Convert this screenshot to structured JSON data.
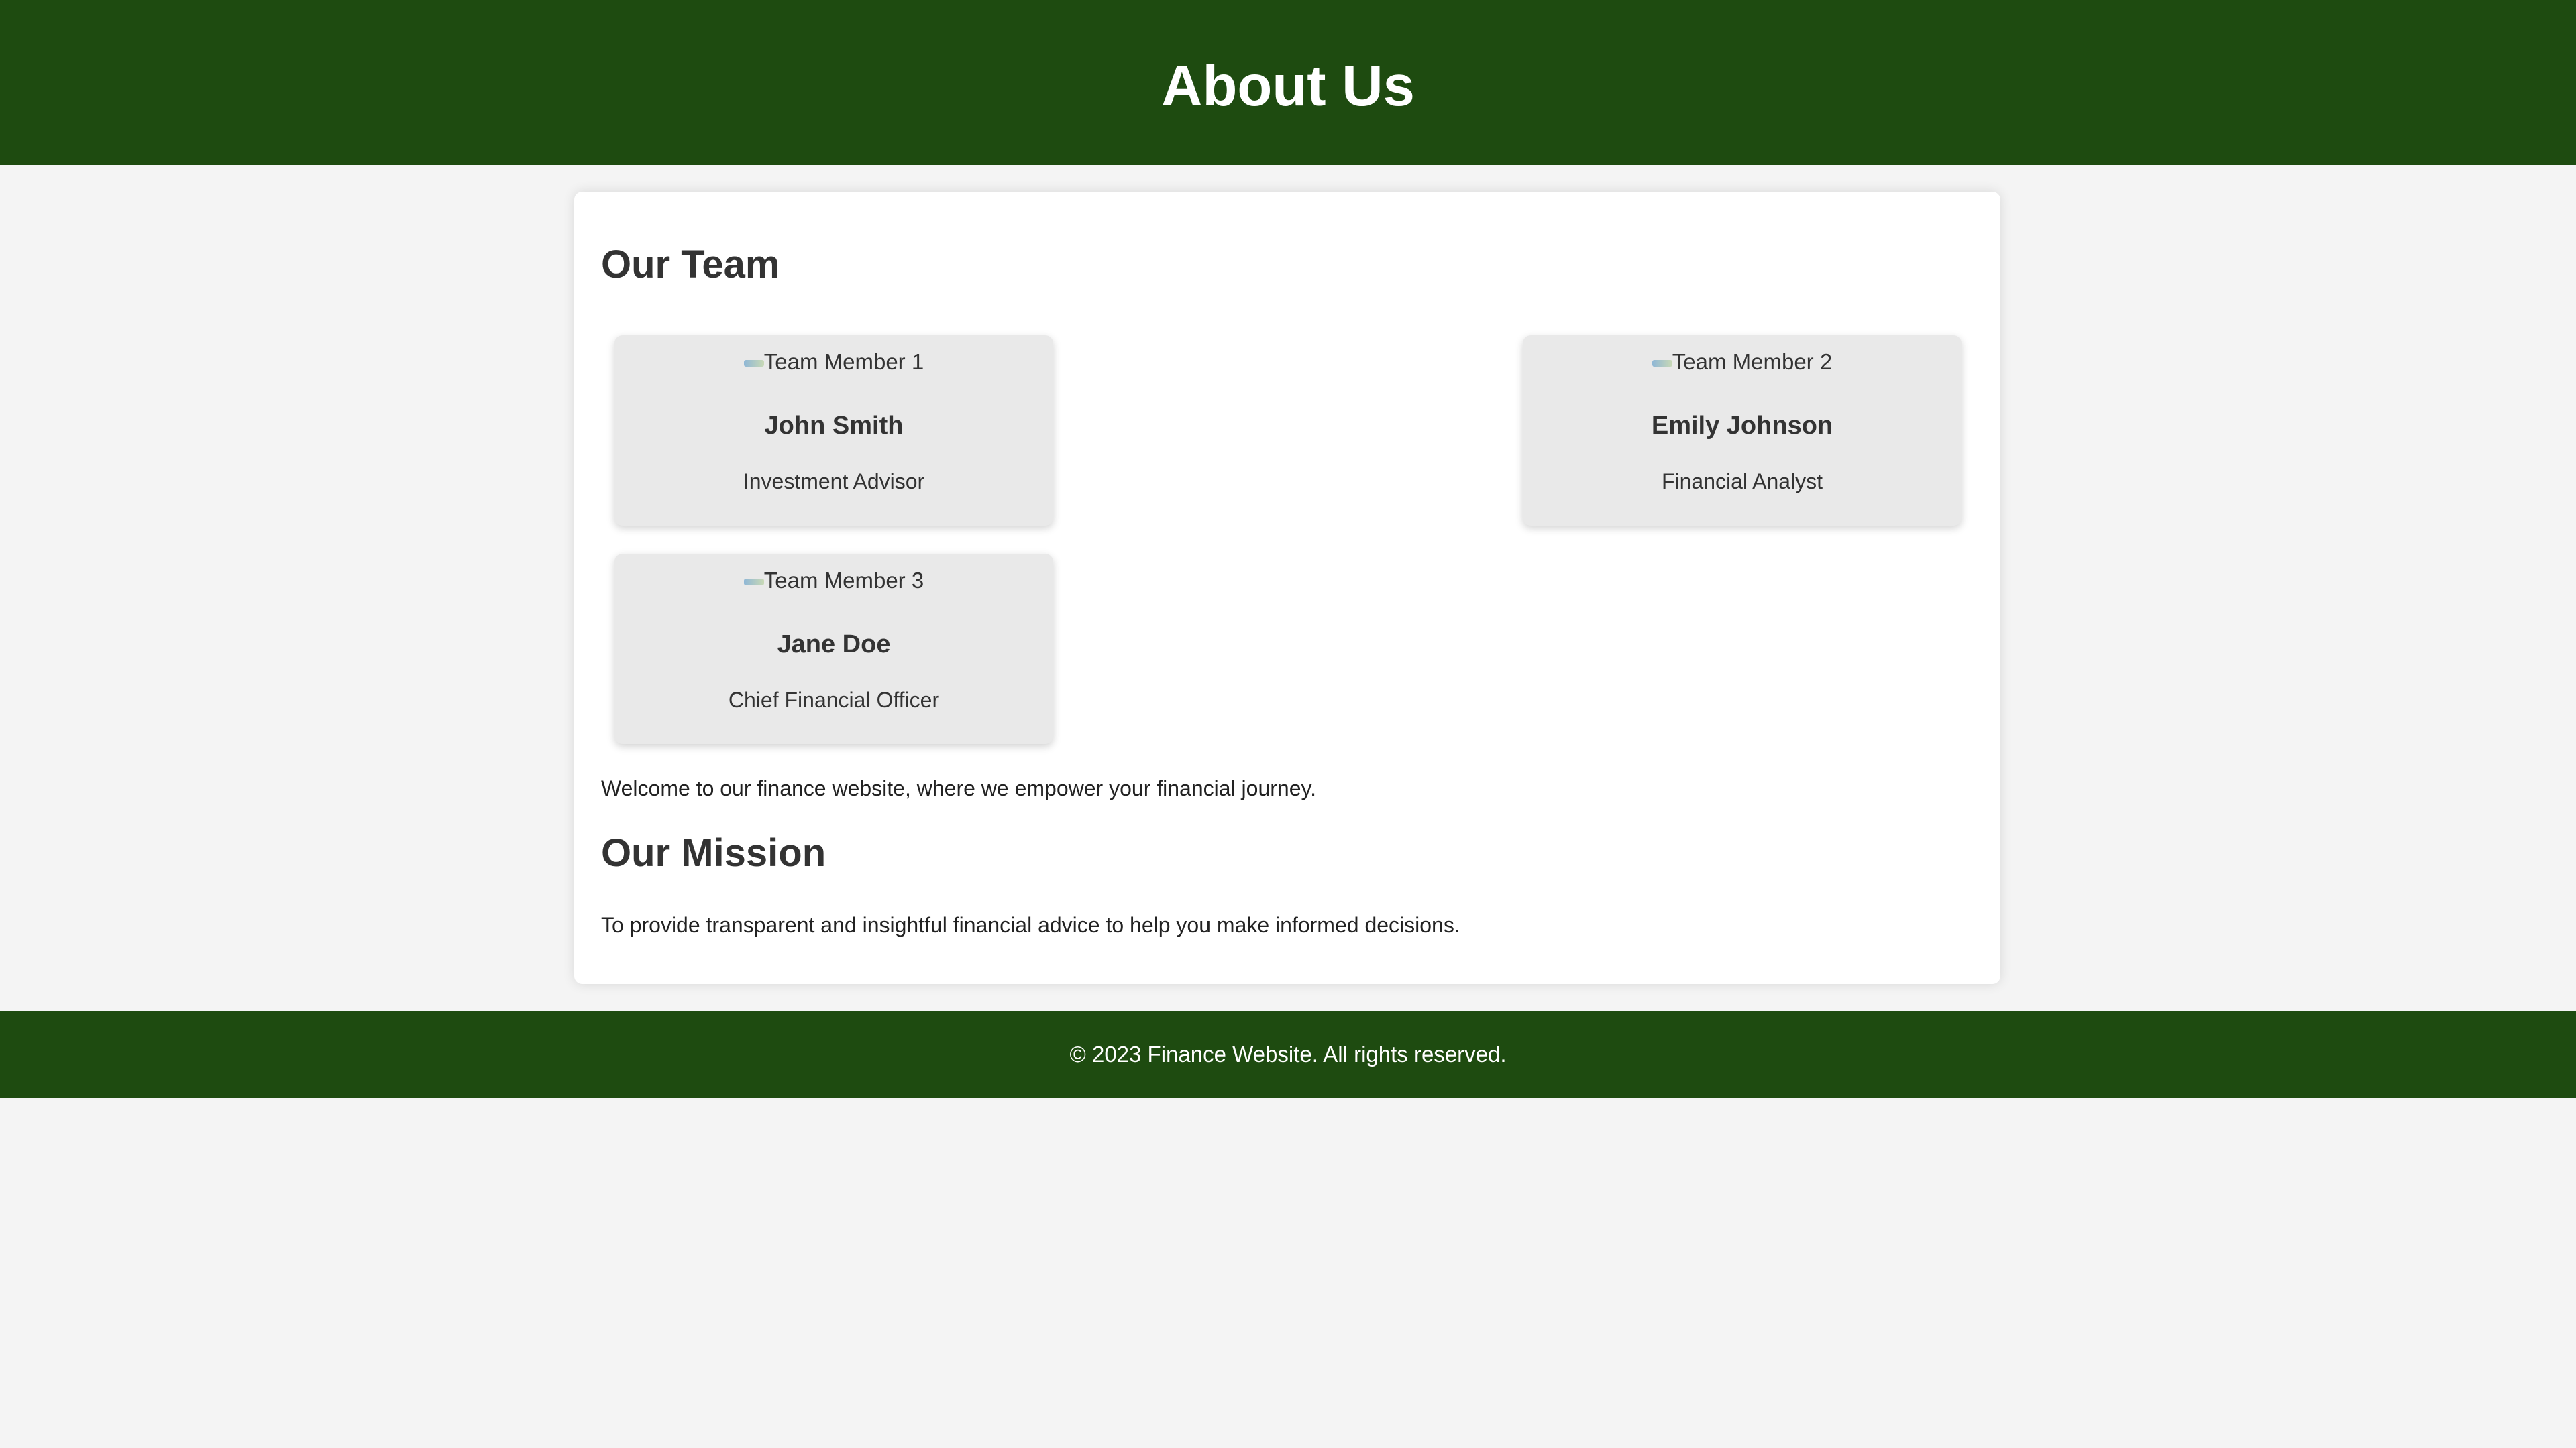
{
  "header": {
    "title": "About Us"
  },
  "team": {
    "heading": "Our Team",
    "members": [
      {
        "photo_alt": "Team Member 1",
        "name": "John Smith",
        "role": "Investment Advisor"
      },
      {
        "photo_alt": "Team Member 2",
        "name": "Emily Johnson",
        "role": "Financial Analyst"
      },
      {
        "photo_alt": "Team Member 3",
        "name": "Jane Doe",
        "role": "Chief Financial Officer"
      }
    ]
  },
  "welcome_text": "Welcome to our finance website, where we empower your financial journey.",
  "mission": {
    "heading": "Our Mission",
    "text": "To provide transparent and insightful financial advice to help you make informed decisions."
  },
  "footer": {
    "text": "© 2023 Finance Website. All rights reserved."
  },
  "colors": {
    "brand_green": "#1e4b10",
    "page_background": "#f4f4f4",
    "card_background": "#e9e9e9"
  }
}
